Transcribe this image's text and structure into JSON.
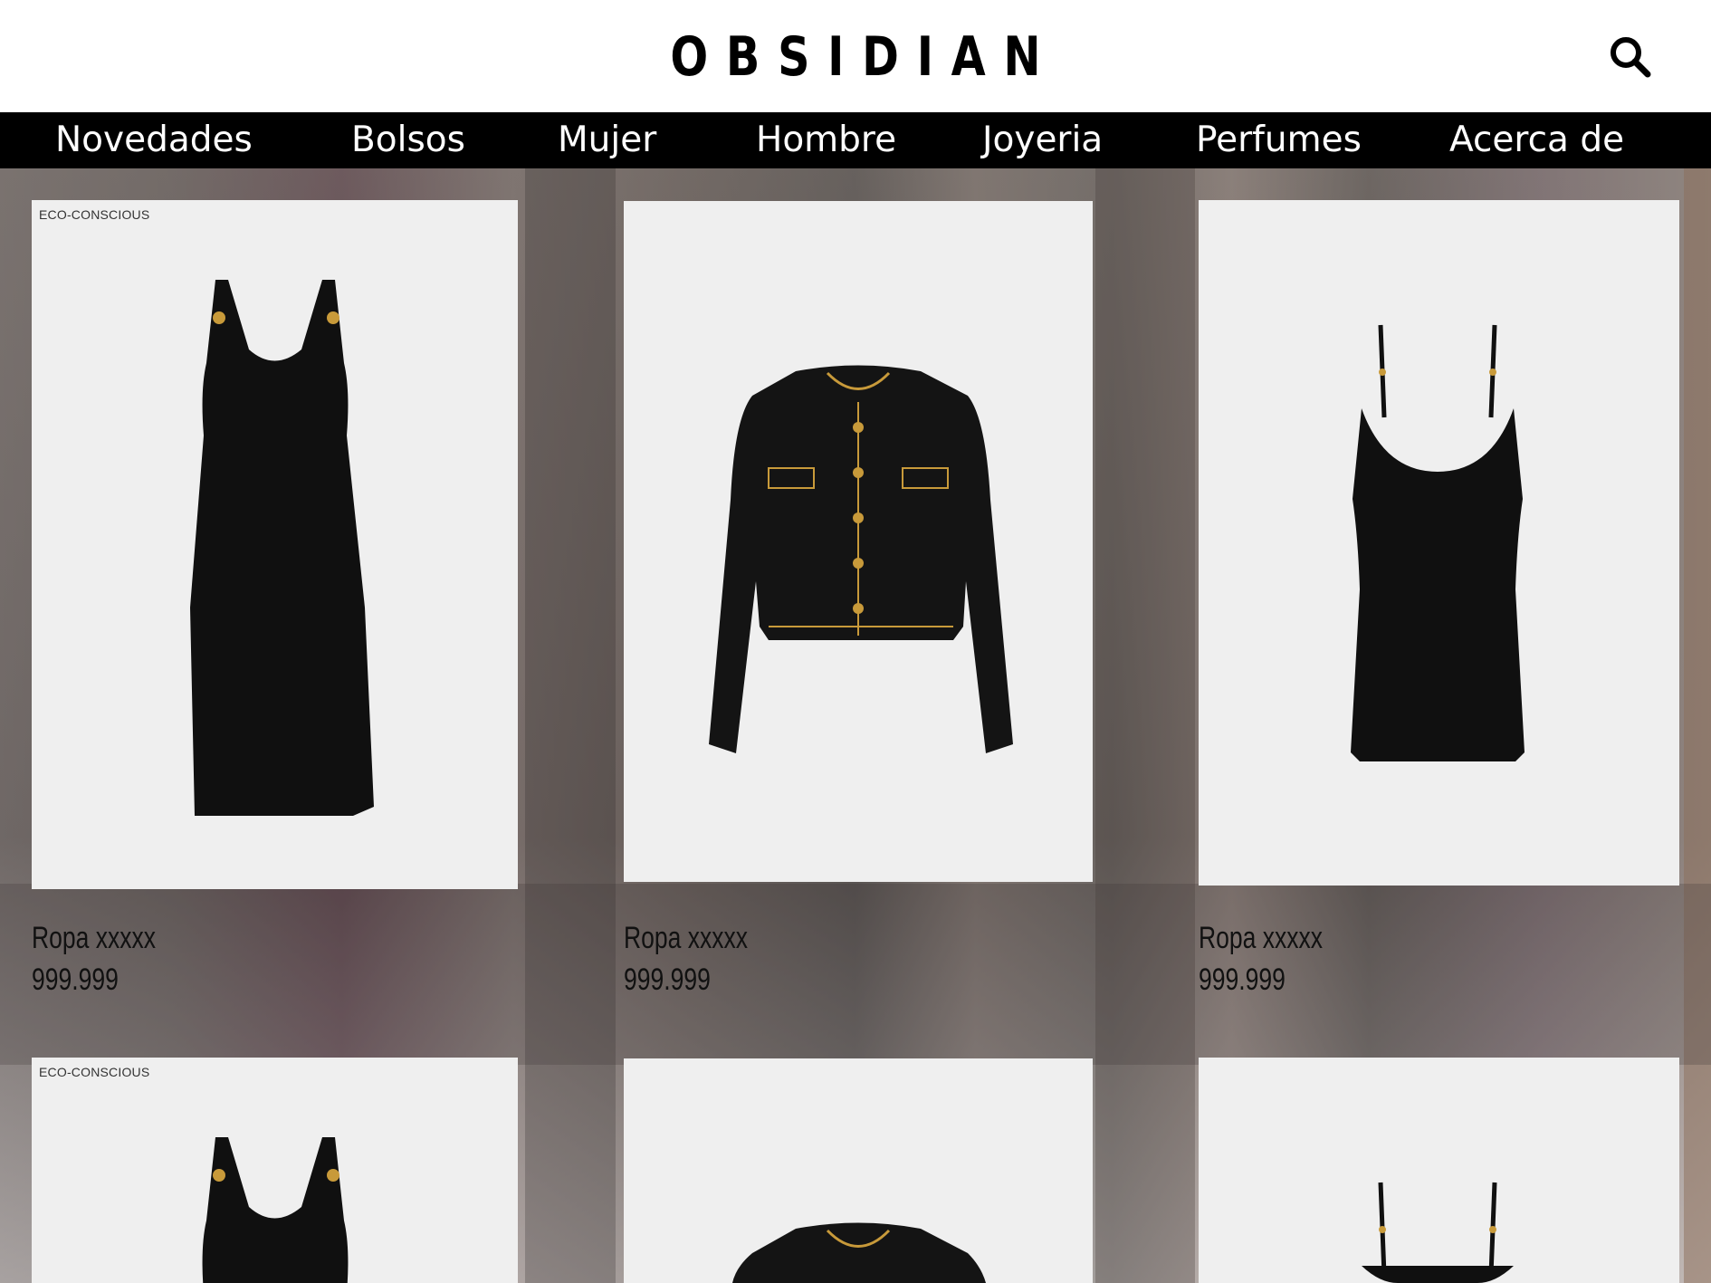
{
  "header": {
    "logo": "OBSIDIAN",
    "search_icon": "search-icon"
  },
  "nav": {
    "items": [
      "Novedades",
      "Bolsos",
      "Mujer",
      "Hombre",
      "Joyeria",
      "Perfumes",
      "Acerca de"
    ]
  },
  "products": [
    {
      "badge": "ECO-CONSCIOUS",
      "name": "Ropa xxxxx",
      "price": "999.999",
      "image": "long-dress"
    },
    {
      "badge": "",
      "name": "Ropa xxxxx",
      "price": "999.999",
      "image": "cardigan-jacket"
    },
    {
      "badge": "",
      "name": "Ropa xxxxx",
      "price": "999.999",
      "image": "slip-dress"
    },
    {
      "badge": "ECO-CONSCIOUS",
      "name": "",
      "price": "",
      "image": "long-dress"
    },
    {
      "badge": "",
      "name": "",
      "price": "",
      "image": "cardigan-jacket"
    },
    {
      "badge": "",
      "name": "",
      "price": "",
      "image": "slip-dress"
    }
  ],
  "colors": {
    "nav_background": "#000000",
    "card_background": "#efefef",
    "accent_gold": "#c89a3a"
  }
}
